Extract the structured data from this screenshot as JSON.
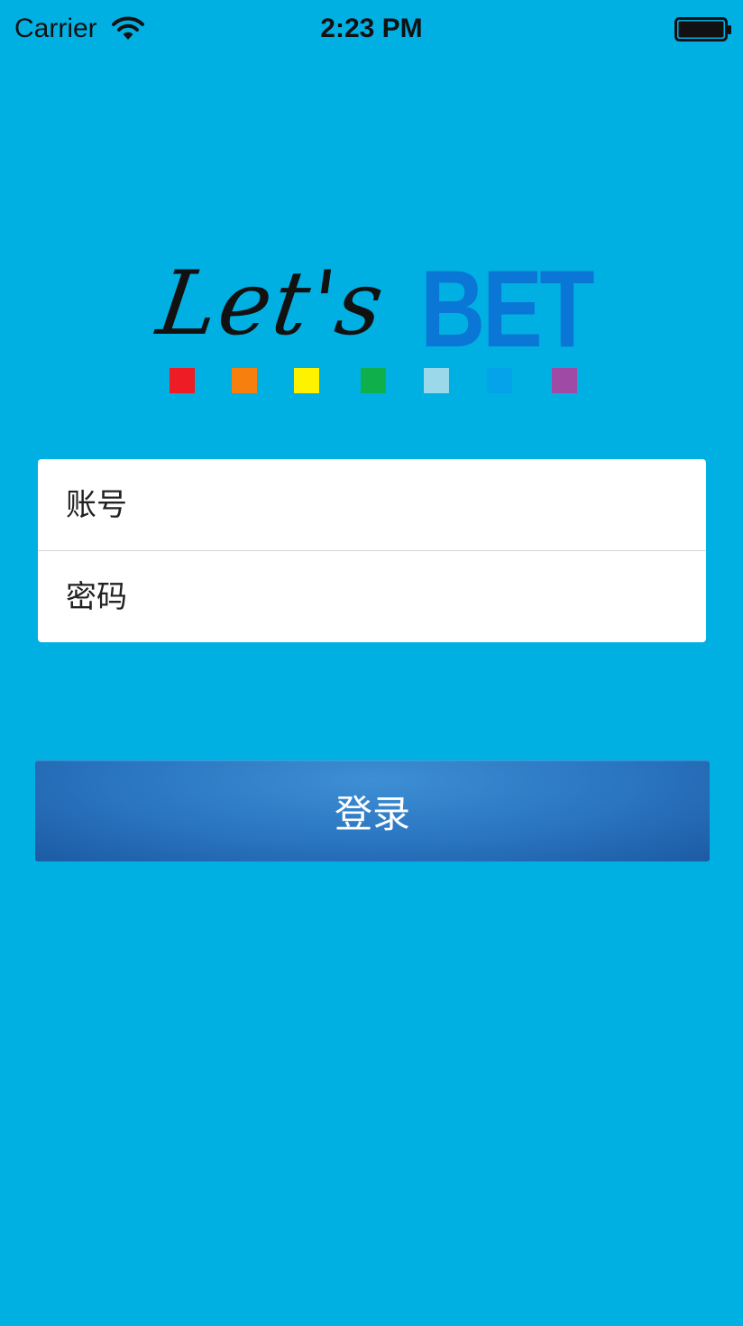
{
  "status_bar": {
    "carrier": "Carrier",
    "time": "2:23 PM",
    "icons": [
      "wifi-icon",
      "battery-icon"
    ]
  },
  "logo": {
    "script_text": "Let's",
    "bold_text": "BET",
    "bold_color": "#0a76d6",
    "square_colors": [
      "#ee1c24",
      "#f77f0e",
      "#fff200",
      "#0fb04b",
      "#9bd8ea",
      "#05a3ea",
      "#9f4aa5"
    ]
  },
  "form": {
    "account_placeholder": "账号",
    "password_placeholder": "密码"
  },
  "login_button": {
    "label": "登录"
  },
  "colors": {
    "background": "#00b0e3",
    "button": "#2a74c0"
  }
}
